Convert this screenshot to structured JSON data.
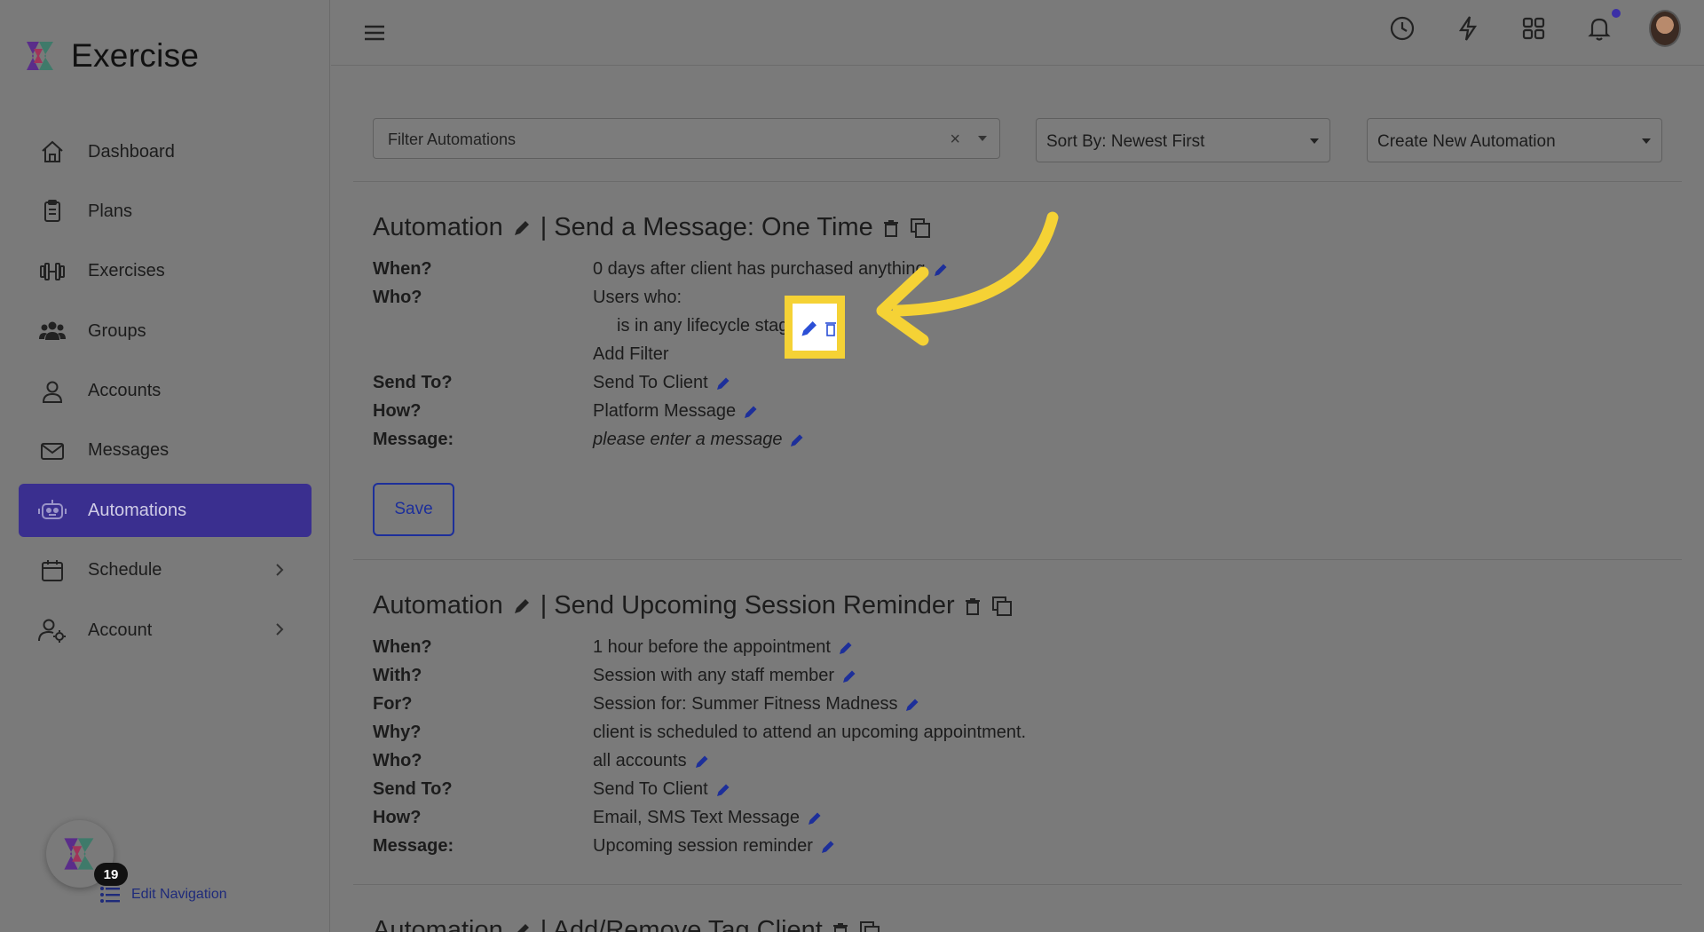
{
  "app": {
    "name": "Exercise"
  },
  "sidebar": {
    "items": [
      {
        "label": "Dashboard",
        "icon": "home-icon",
        "active": false
      },
      {
        "label": "Plans",
        "icon": "clipboard-icon",
        "active": false
      },
      {
        "label": "Exercises",
        "icon": "dumbbell-icon",
        "active": false
      },
      {
        "label": "Groups",
        "icon": "users-icon",
        "active": false
      },
      {
        "label": "Accounts",
        "icon": "user-icon",
        "active": false
      },
      {
        "label": "Messages",
        "icon": "envelope-icon",
        "active": false
      },
      {
        "label": "Automations",
        "icon": "robot-icon",
        "active": true
      },
      {
        "label": "Schedule",
        "icon": "calendar-icon",
        "active": false,
        "expandable": true
      },
      {
        "label": "Account",
        "icon": "user-gear-icon",
        "active": false,
        "expandable": true
      }
    ],
    "badge_count": "19",
    "edit_nav_label": "Edit Navigation"
  },
  "toolbar": {
    "filter_placeholder": "Filter Automations",
    "filter_clear": "×",
    "sort_label": "Sort By: Newest First",
    "create_label": "Create New Automation"
  },
  "automations": [
    {
      "prefix": "Automation",
      "name": "| Send a Message: One Time",
      "rows": [
        {
          "label": "When?",
          "value": "0 days after client has purchased anything"
        },
        {
          "label": "Who?",
          "value": "Users who:"
        },
        {
          "label": "",
          "value": "is in any lifecycle stage"
        },
        {
          "label": "",
          "value": "Add Filter"
        },
        {
          "label": "Send To?",
          "value": "Send To Client"
        },
        {
          "label": "How?",
          "value": "Platform Message"
        },
        {
          "label": "Message:",
          "value": "please enter a message"
        }
      ],
      "save_label": "Save"
    },
    {
      "prefix": "Automation",
      "name": "| Send Upcoming Session Reminder",
      "rows": [
        {
          "label": "When?",
          "value": "1 hour before the appointment"
        },
        {
          "label": "With?",
          "value": "Session with any staff member"
        },
        {
          "label": "For?",
          "value": "Session for: Summer Fitness Madness"
        },
        {
          "label": "Why?",
          "value": "client is scheduled to attend an upcoming appointment."
        },
        {
          "label": "Who?",
          "value": "all accounts"
        },
        {
          "label": "Send To?",
          "value": "Send To Client"
        },
        {
          "label": "How?",
          "value": "Email, SMS Text Message"
        },
        {
          "label": "Message:",
          "value": "Upcoming session reminder"
        }
      ]
    },
    {
      "prefix": "Automation",
      "name": "| Add/Remove Tag Client"
    }
  ],
  "colors": {
    "accent": "#3a2f8f",
    "link": "#1d2f9a",
    "highlight": "#f5d235",
    "overlay": "#7a7a7a"
  }
}
